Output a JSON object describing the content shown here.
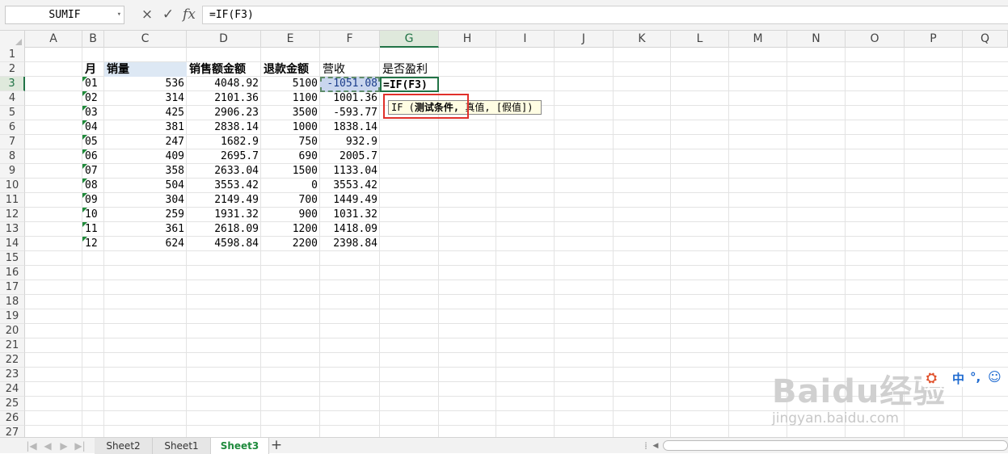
{
  "formula_bar": {
    "name_box": "SUMIF",
    "cancel_icon": "×",
    "confirm_icon": "✓",
    "fx_icon": "fx",
    "formula": "=IF(F3)"
  },
  "columns": [
    "A",
    "B",
    "C",
    "D",
    "E",
    "F",
    "G",
    "H",
    "I",
    "J",
    "K",
    "L",
    "M",
    "N",
    "O",
    "P",
    "Q"
  ],
  "rows": [
    "1",
    "2",
    "3",
    "4",
    "5",
    "6",
    "7",
    "8",
    "9",
    "10",
    "11",
    "12",
    "13",
    "14",
    "15",
    "16",
    "17",
    "18",
    "19",
    "20",
    "21",
    "22",
    "23",
    "24",
    "25",
    "26",
    "27"
  ],
  "headers": {
    "B": "月",
    "C": "销量",
    "D": "销售额金额",
    "E": "退款金额",
    "F": "营收",
    "G": "是否盈利"
  },
  "table": [
    {
      "month": "01",
      "qty": "536",
      "sales": "4048.92",
      "refund": "5100",
      "revenue": "-1051.08"
    },
    {
      "month": "02",
      "qty": "314",
      "sales": "2101.36",
      "refund": "1100",
      "revenue": "1001.36"
    },
    {
      "month": "03",
      "qty": "425",
      "sales": "2906.23",
      "refund": "3500",
      "revenue": "-593.77"
    },
    {
      "month": "04",
      "qty": "381",
      "sales": "2838.14",
      "refund": "1000",
      "revenue": "1838.14"
    },
    {
      "month": "05",
      "qty": "247",
      "sales": "1682.9",
      "refund": "750",
      "revenue": "932.9"
    },
    {
      "month": "06",
      "qty": "409",
      "sales": "2695.7",
      "refund": "690",
      "revenue": "2005.7"
    },
    {
      "month": "07",
      "qty": "358",
      "sales": "2633.04",
      "refund": "1500",
      "revenue": "1133.04"
    },
    {
      "month": "08",
      "qty": "504",
      "sales": "3553.42",
      "refund": "0",
      "revenue": "3553.42"
    },
    {
      "month": "09",
      "qty": "304",
      "sales": "2149.49",
      "refund": "700",
      "revenue": "1449.49"
    },
    {
      "month": "10",
      "qty": "259",
      "sales": "1931.32",
      "refund": "900",
      "revenue": "1031.32"
    },
    {
      "month": "11",
      "qty": "361",
      "sales": "2618.09",
      "refund": "1200",
      "revenue": "1418.09"
    },
    {
      "month": "12",
      "qty": "624",
      "sales": "4598.84",
      "refund": "2200",
      "revenue": "2398.84"
    }
  ],
  "active_cell_text": "=IF(F3)",
  "tooltip": {
    "pre": "IF (",
    "bold": "测试条件,",
    "post": " 真值, [假值])"
  },
  "sheets": [
    {
      "label": "Sheet2",
      "active": false
    },
    {
      "label": "Sheet1",
      "active": false
    },
    {
      "label": "Sheet3",
      "active": true
    }
  ],
  "add_sheet": "+",
  "watermark": {
    "main": "Baidu经验",
    "sub": "jingyan.baidu.com"
  },
  "ime": "中",
  "colors": {
    "accent": "#217346",
    "active_tab": "#1e8a3c",
    "highlight": "#e0302a"
  }
}
